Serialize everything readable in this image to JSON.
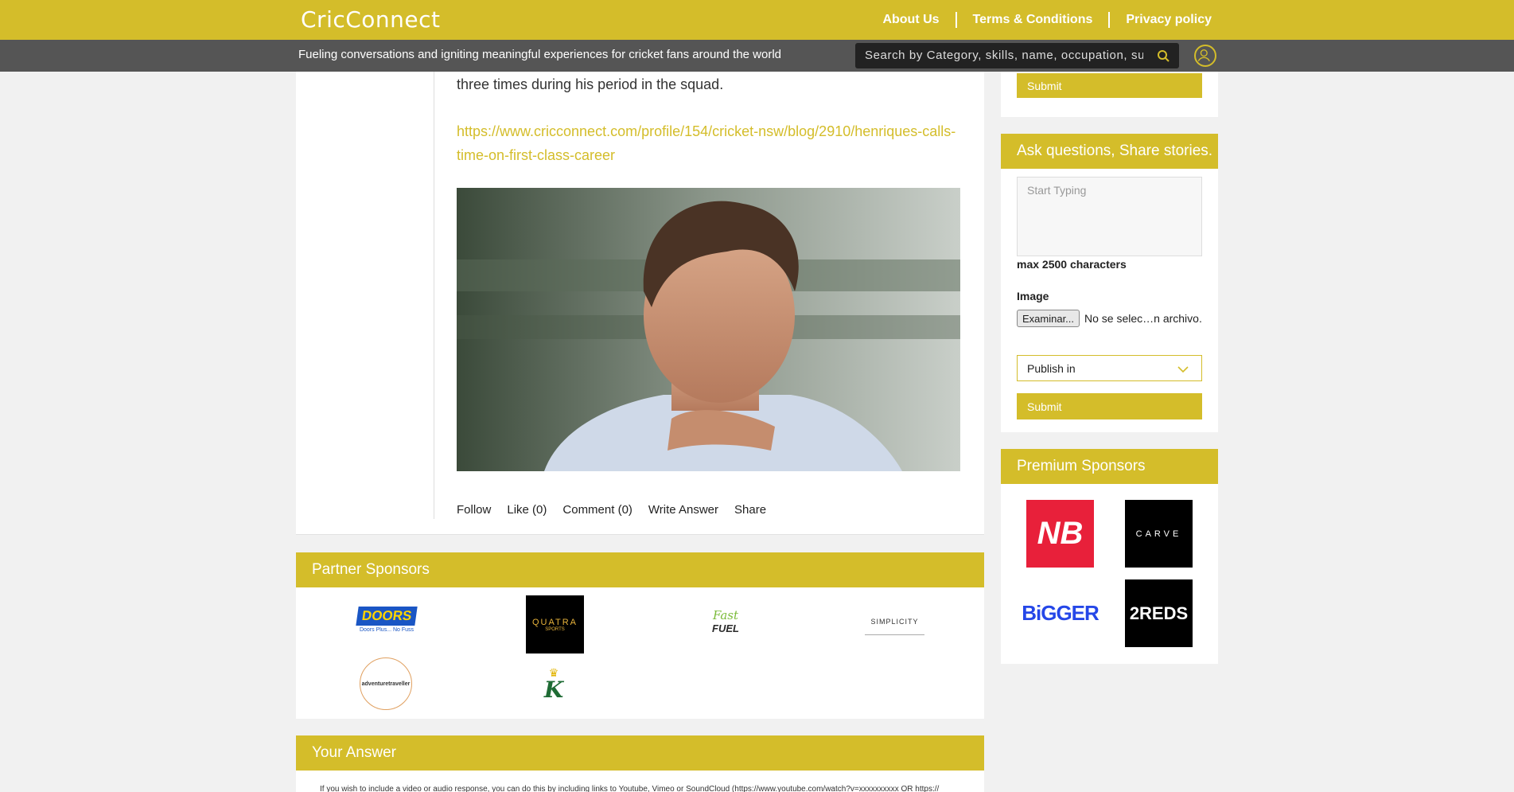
{
  "header": {
    "logo": "CricConnect",
    "nav": [
      "About Us",
      "Terms & Conditions",
      "Privacy policy"
    ],
    "tagline": "Fueling conversations and igniting meaningful experiences for cricket fans around the world",
    "search_placeholder": "Search by Category, skills, name, occupation, su"
  },
  "post": {
    "text": "three times during his period in the squad.",
    "link": "https://www.cricconnect.com/profile/154/cricket-nsw/blog/2910/henriques-calls-time-on-first-class-career",
    "actions": [
      "Follow",
      "Like (0)",
      "Comment (0)",
      "Write Answer",
      "Share"
    ]
  },
  "partner_sponsors": {
    "title": "Partner Sponsors",
    "logos": {
      "doors": "DOORS",
      "doors_sub": "PLUS",
      "doors_tag": "Doors Plus... No Fuss",
      "quatra": "QUATRA",
      "quatra_sub": "SPORTS",
      "fastfuel_1": "Fast",
      "fastfuel_2": "FUEL",
      "simplicity": "SIMPLICITY",
      "adventure": "adventuretraveller",
      "k": "K"
    }
  },
  "your_answer": {
    "title": "Your Answer",
    "note": "If you wish to include a video or audio response, you can do this by including links to Youtube, Vimeo or SoundCloud (https://www.youtube.com/watch?v=xxxxxxxxxx OR https://"
  },
  "right": {
    "submit_top": "Submit",
    "ask_title": "Ask questions, Share stories.",
    "textarea_placeholder": "Start Typing",
    "max_chars": "max 2500 characters",
    "image_label": "Image",
    "file_button": "Examinar...",
    "file_status": "No se selec…n archivo.",
    "publish_in": "Publish in",
    "submit": "Submit",
    "premium_title": "Premium Sponsors",
    "premium_logos": {
      "nb": "NB",
      "carve": "CARVE",
      "bigger": "BiGGER",
      "reds": "2REDS"
    }
  },
  "colors": {
    "accent": "#d4bd2a",
    "grey_bar": "#555555"
  }
}
